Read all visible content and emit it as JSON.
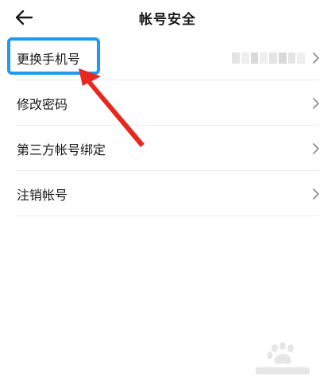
{
  "header": {
    "title": "帐号安全",
    "back_icon": "arrow-left-icon"
  },
  "settings": {
    "items": [
      {
        "label": "更换手机号",
        "value": "masked",
        "icon": "chevron-right-icon"
      },
      {
        "label": "修改密码",
        "icon": "chevron-right-icon"
      },
      {
        "label": "第三方帐号绑定",
        "icon": "chevron-right-icon"
      },
      {
        "label": "注销帐号",
        "icon": "chevron-right-icon"
      }
    ]
  },
  "annotation": {
    "highlight_color": "#1e9bf0",
    "arrow_color": "#e8281e"
  },
  "colors": {
    "text": "#1a1a1a",
    "divider": "#ececec",
    "chevron": "#8a8a8a"
  }
}
